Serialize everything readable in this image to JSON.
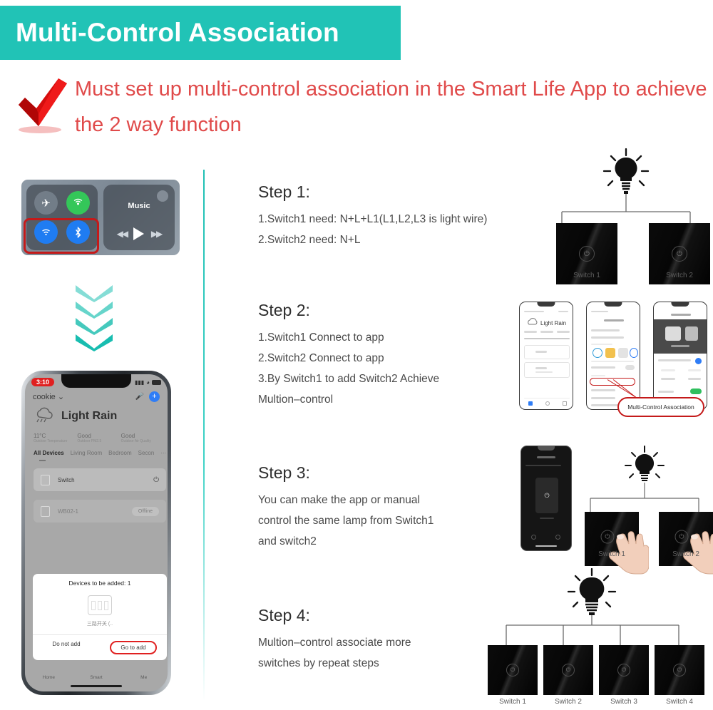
{
  "header": {
    "title": "Multi-Control Association",
    "band_color": "#21c3b6"
  },
  "warning": {
    "icon": "red-checkmark-icon",
    "text": "Must set up multi-control association in the Smart Life App to achieve the 2 way function",
    "color": "#e04a4a"
  },
  "control_center": {
    "airplane_icon": "airplane-icon",
    "cellular_icon": "cellular-icon",
    "wifi_icon": "wifi-icon",
    "bluetooth_icon": "bluetooth-icon",
    "music_label": "Music",
    "airplay_icon": "airplay-icon",
    "prev_icon": "rewind-icon",
    "play_icon": "play-icon",
    "next_icon": "fast-forward-icon"
  },
  "arrows": {
    "count": 4,
    "color": "#3bc9bd",
    "icon": "chevron-down-icon"
  },
  "phone": {
    "status": {
      "time": "3:10",
      "signal_icon": "signal-icon",
      "wifi_icon": "wifi-icon",
      "battery_icon": "battery-icon"
    },
    "home": "cookie",
    "chevron_icon": "chevron-down-icon",
    "mic_icon": "microphone-icon",
    "add_icon": "plus-icon",
    "weather_icon": "rain-cloud-icon",
    "weather_title": "Light Rain",
    "stats": [
      {
        "value": "11°C",
        "label": "Outdoor Temperature"
      },
      {
        "value": "Good",
        "label": "Outdoor PM2.5"
      },
      {
        "value": "Good",
        "label": "Outdoor Air Quality"
      }
    ],
    "tabs": [
      "All Devices",
      "Living Room",
      "Bedroom",
      "Secon"
    ],
    "tabs_more": "···",
    "devices": [
      {
        "name": "Switch",
        "action_icon": "power-icon",
        "status": ""
      },
      {
        "name": "WB02-1",
        "action_icon": "",
        "status": "Offline"
      }
    ],
    "modal": {
      "title": "Devices to be added: 1",
      "device_icon": "wall-switch-icon",
      "device_name": "三路开关 (..",
      "cancel_label": "Do not add",
      "confirm_label": "Go to add"
    },
    "tabbar": [
      "Home",
      "Smart",
      "Me"
    ]
  },
  "steps": [
    {
      "title": "Step 1:",
      "lines": [
        "1.Switch1 need: N+L+L1(L1,L2,L3 is light wire)",
        "2.Switch2 need: N+L"
      ]
    },
    {
      "title": "Step 2:",
      "lines": [
        "1.Switch1 Connect to app",
        "2.Switch2 Connect to app",
        "3.By Switch1 to add Switch2 Achieve",
        "Multion–control"
      ]
    },
    {
      "title": "Step 3:",
      "lines": [
        "You can make the app or manual",
        "control the same lamp from Switch1",
        "and switch2"
      ]
    },
    {
      "title": "Step 4:",
      "lines": [
        "Multion–control associate more",
        "switches by repeat steps"
      ]
    }
  ],
  "diagrams": {
    "step1": {
      "bulb_icon": "light-bulb-icon",
      "switches": [
        "Switch 1",
        "Switch 2"
      ],
      "switch_icon": "power-icon"
    },
    "step2": {
      "callout_label": "Multi-Control Association",
      "phone_count": 3
    },
    "step3": {
      "bulb_icon": "light-bulb-icon",
      "switches": [
        "Switch 1",
        "Switch 2"
      ],
      "hand_icon": "pointing-hand-icon",
      "switch_icon": "power-icon"
    },
    "step4": {
      "bulb_icon": "light-bulb-icon",
      "switches": [
        "Switch 1",
        "Switch 2",
        "Switch 3",
        "Switch 4"
      ],
      "switch_icon": "power-icon"
    }
  }
}
